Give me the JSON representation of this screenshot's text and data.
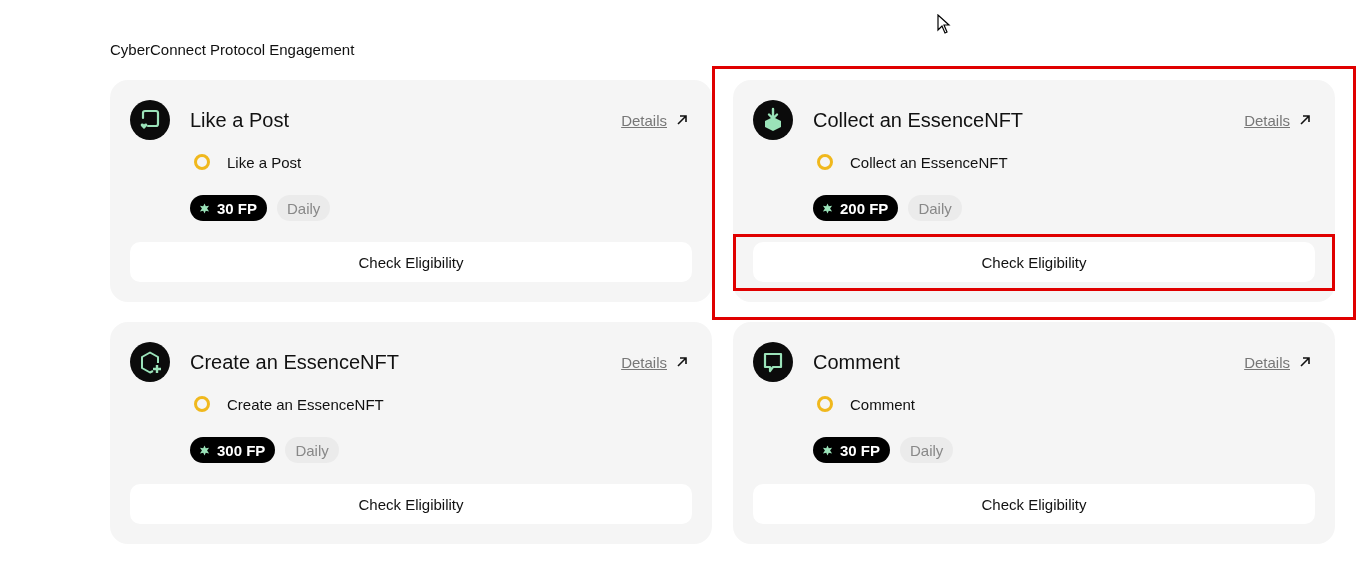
{
  "section_title": "CyberConnect Protocol Engagement",
  "cards": [
    {
      "kind": "chat-heart",
      "title": "Like a Post",
      "details_link": "Details",
      "task": {
        "label": "Like a Post",
        "done": false
      },
      "points": "30 FP",
      "frequency": "Daily",
      "button": "Check Eligibility",
      "highlighted": false,
      "button_highlighted": false
    },
    {
      "kind": "download-box",
      "title": "Collect an EssenceNFT",
      "details_link": "Details",
      "task": {
        "label": "Collect an EssenceNFT",
        "done": false
      },
      "points": "200 FP",
      "frequency": "Daily",
      "button": "Check Eligibility",
      "highlighted": true,
      "button_highlighted": true
    },
    {
      "kind": "hexagon-plus",
      "title": "Create an EssenceNFT",
      "details_link": "Details",
      "task": {
        "label": "Create an EssenceNFT",
        "done": false
      },
      "points": "300 FP",
      "frequency": "Daily",
      "button": "Check Eligibility",
      "highlighted": false,
      "button_highlighted": false
    },
    {
      "kind": "speech-bubble",
      "title": "Comment",
      "details_link": "Details",
      "task": {
        "label": "Comment",
        "done": false
      },
      "points": "30 FP",
      "frequency": "Daily",
      "button": "Check Eligibility",
      "highlighted": false,
      "button_highlighted": false
    }
  ]
}
